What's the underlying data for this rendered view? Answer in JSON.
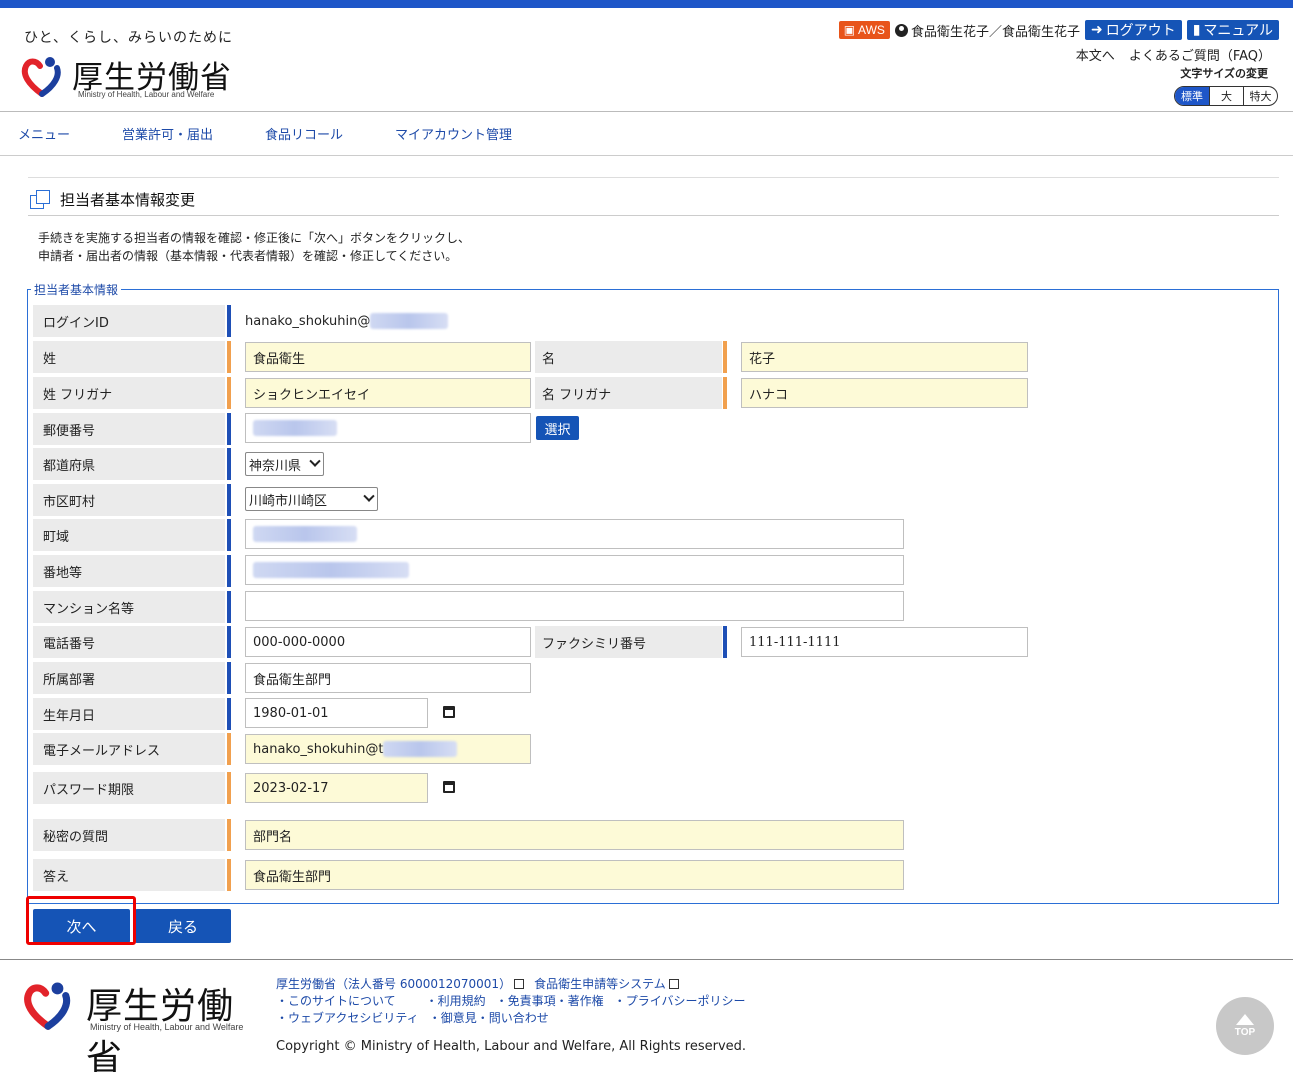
{
  "header": {
    "tagline": "ひと、くらし、みらいのために",
    "logo_text": "厚生労働省",
    "logo_en": "Ministry of Health, Labour and Welfare",
    "aws_badge": "AWS",
    "user_name": "食品衛生花子／食品衛生花子",
    "logout": "ログアウト",
    "manual": "マニュアル",
    "link_main": "本文へ",
    "link_faq": "よくあるご質問（FAQ）",
    "textsize_label": "文字サイズの変更",
    "textsize_options": [
      "標準",
      "大",
      "特大"
    ]
  },
  "nav": [
    "メニュー",
    "営業許可・届出",
    "食品リコール",
    "マイアカウント管理"
  ],
  "page": {
    "title": "担当者基本情報変更",
    "instruction_1": "手続きを実施する担当者の情報を確認・修正後に「次へ」ボタンをクリックし、",
    "instruction_2": "申請者・届出者の情報（基本情報・代表者情報）を確認・修正してください。",
    "legend": "担当者基本情報"
  },
  "form": {
    "login_id_label": "ログインID",
    "login_id_value": "hanako_shokuhin@",
    "sei_label": "姓",
    "sei_value": "食品衛生",
    "mei_label": "名",
    "mei_value": "花子",
    "sei_kana_label": "姓 フリガナ",
    "sei_kana_value": "ショクヒンエイセイ",
    "mei_kana_label": "名 フリガナ",
    "mei_kana_value": "ハナコ",
    "postal_label": "郵便番号",
    "postal_select_btn": "選択",
    "pref_label": "都道府県",
    "pref_value": "神奈川県",
    "city_label": "市区町村",
    "city_value": "川崎市川崎区",
    "town_label": "町域",
    "banchi_label": "番地等",
    "mansion_label": "マンション名等",
    "tel_label": "電話番号",
    "tel_value": "000-000-0000",
    "fax_label": "ファクシミリ番号",
    "fax_value": "111-111-1111",
    "dept_label": "所属部署",
    "dept_value": "食品衛生部門",
    "birth_label": "生年月日",
    "birth_value": "1980-01-01",
    "email_label": "電子メールアドレス",
    "email_value": "hanako_shokuhin@t",
    "pw_label": "パスワード期限",
    "pw_value": "2023-02-17",
    "secret_q_label": "秘密の質問",
    "secret_q_value": "部門名",
    "answer_label": "答え",
    "answer_value": "食品衛生部門"
  },
  "buttons": {
    "next": "次へ",
    "back": "戻る"
  },
  "footer": {
    "org": "厚生労働省（法人番号 6000012070001）",
    "system": "食品衛生申請等システム",
    "links_1": [
      "・このサイトについて",
      "・利用規約",
      "・免責事項・著作権",
      "・プライバシーポリシー"
    ],
    "links_2": [
      "・ウェブアクセシビリティ",
      "・御意見・問い合わせ"
    ],
    "copyright": "Copyright © Ministry of Health, Labour and Welfare, All Rights reserved.",
    "top": "TOP"
  },
  "colors": {
    "brand_blue": "#1554b6",
    "required_marker": "#f1a04e",
    "optional_marker": "#1e4fb6",
    "required_field_bg": "#fdfad7",
    "highlight": "#ee0000"
  }
}
